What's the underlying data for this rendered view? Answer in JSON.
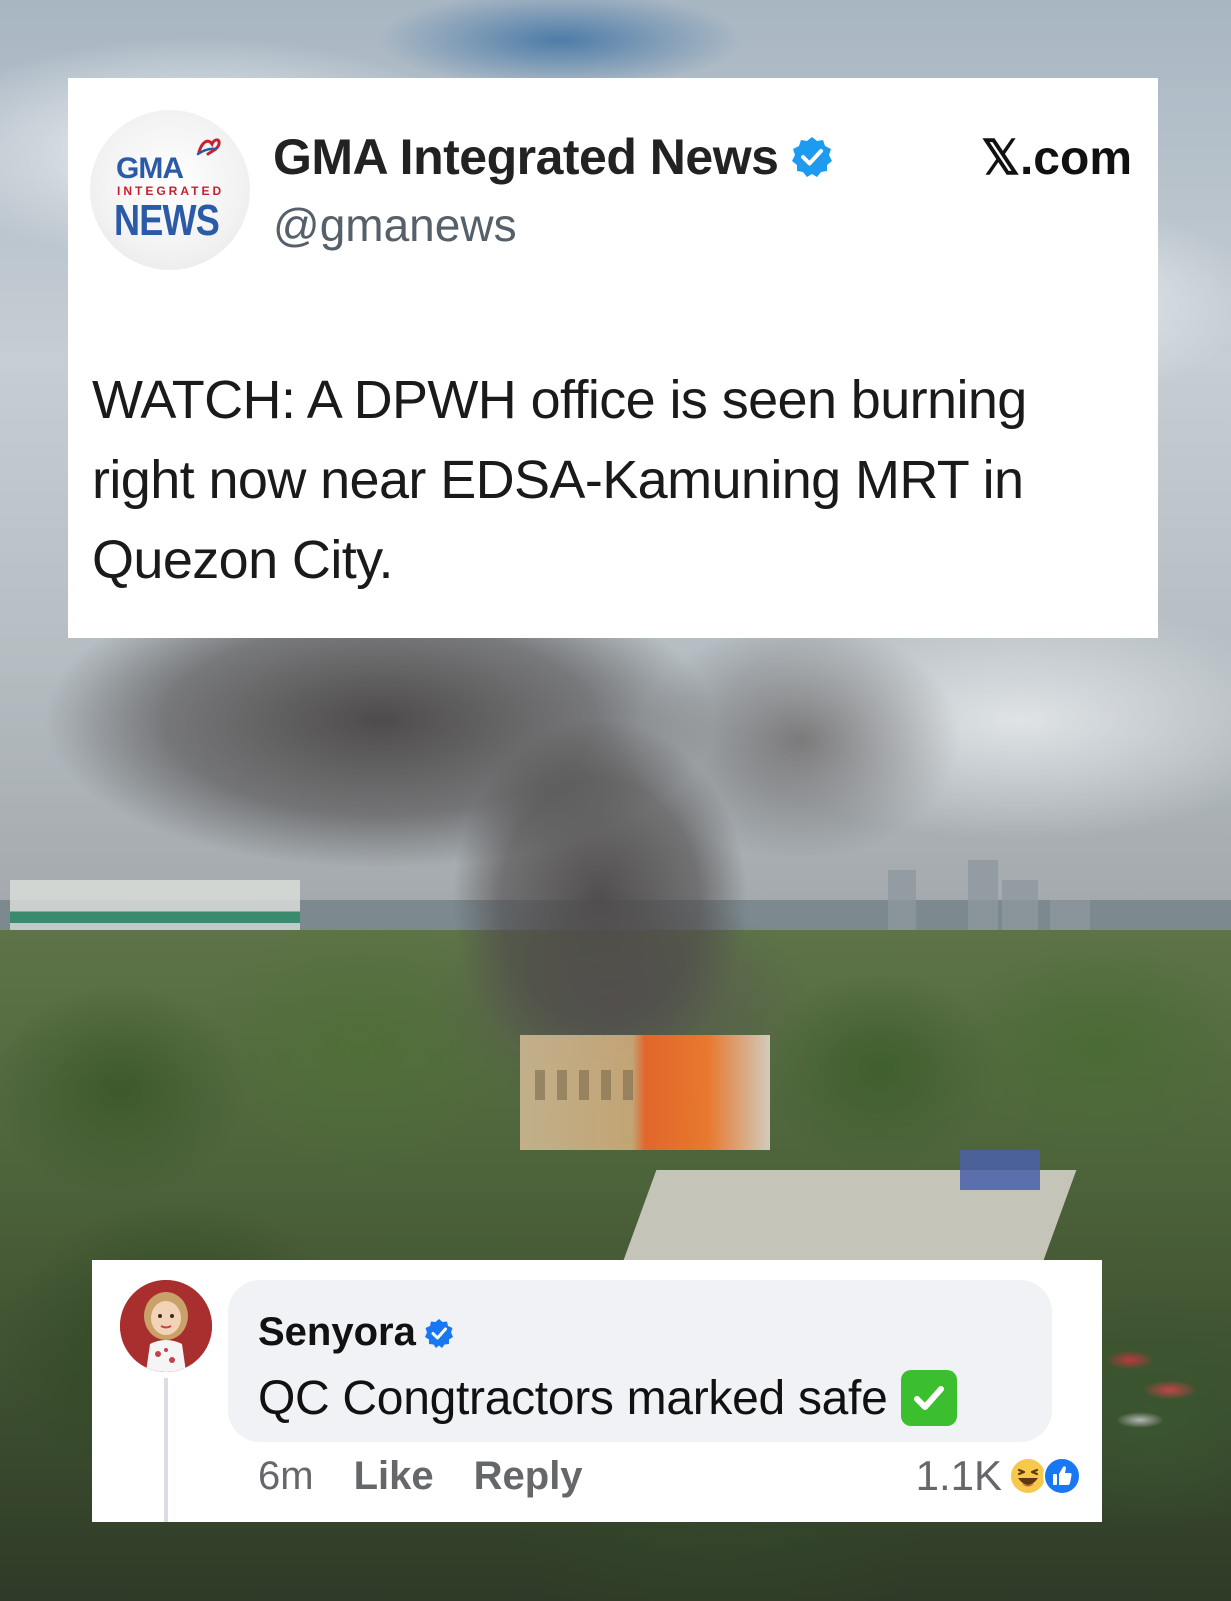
{
  "tweet": {
    "account_name": "GMA Integrated News",
    "handle": "@gmanews",
    "source": "𝕏.com",
    "text": "WATCH: A DPWH office is seen burning right now near EDSA-Kamuning MRT in Quezon City.",
    "avatar_logo": {
      "top": "GMA",
      "middle": "INTEGRATED",
      "bottom": "NEWS"
    },
    "verified": true,
    "badge_color": "#1d9bf0"
  },
  "comment": {
    "author": "Senyora",
    "verified": true,
    "text": "QC Congtractors marked safe",
    "emoji": "check-mark-button",
    "time": "6m",
    "actions": [
      "Like",
      "Reply"
    ],
    "reaction_count": "1.1K",
    "reactions": [
      "haha-icon",
      "like-icon"
    ]
  },
  "colors": {
    "facebook_blue": "#1877f2",
    "bubble_bg": "#f0f2f5",
    "meta_text": "#65676b",
    "emoji_green": "#3bbf2e"
  }
}
